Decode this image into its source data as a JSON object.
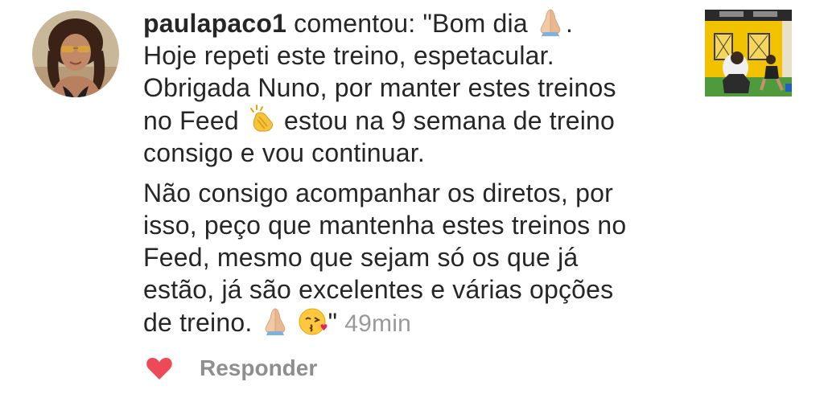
{
  "comment": {
    "username": "paulapaco1",
    "verb": "comentou:",
    "line_1_text": "\"Bom dia",
    "line_1_tail": ".",
    "line_2": "Hoje repeti este treino, espetacular.",
    "line_3": "Obrigada Nuno, por manter estes treinos",
    "line_4_before": "no Feed",
    "line_4_after": "estou na 9 semana de treino",
    "line_5": "consigo e vou continuar.",
    "line_6": "Não consigo acompanhar os diretos, por",
    "line_7": "isso, peço que mantenha estes treinos no",
    "line_8": "Feed, mesmo que sejam só os que já",
    "line_9": "estão, já são excelentes e várias opções",
    "line_10_before": "de treino.",
    "line_10_quote": "\"",
    "timestamp": "49min"
  },
  "emojis": {
    "praying_hands": "praying-hands-icon",
    "clapping_hands": "clapping-hands-icon",
    "kissing_face": "kissing-face-icon"
  },
  "actions": {
    "like_icon": "heart-icon",
    "like_color": "#ed4956",
    "reply_label": "Responder",
    "reply_color": "#8e8e8e"
  },
  "colors": {
    "text": "#262626",
    "timestamp": "#999999",
    "thumbnail_wall": "#f2c200"
  }
}
